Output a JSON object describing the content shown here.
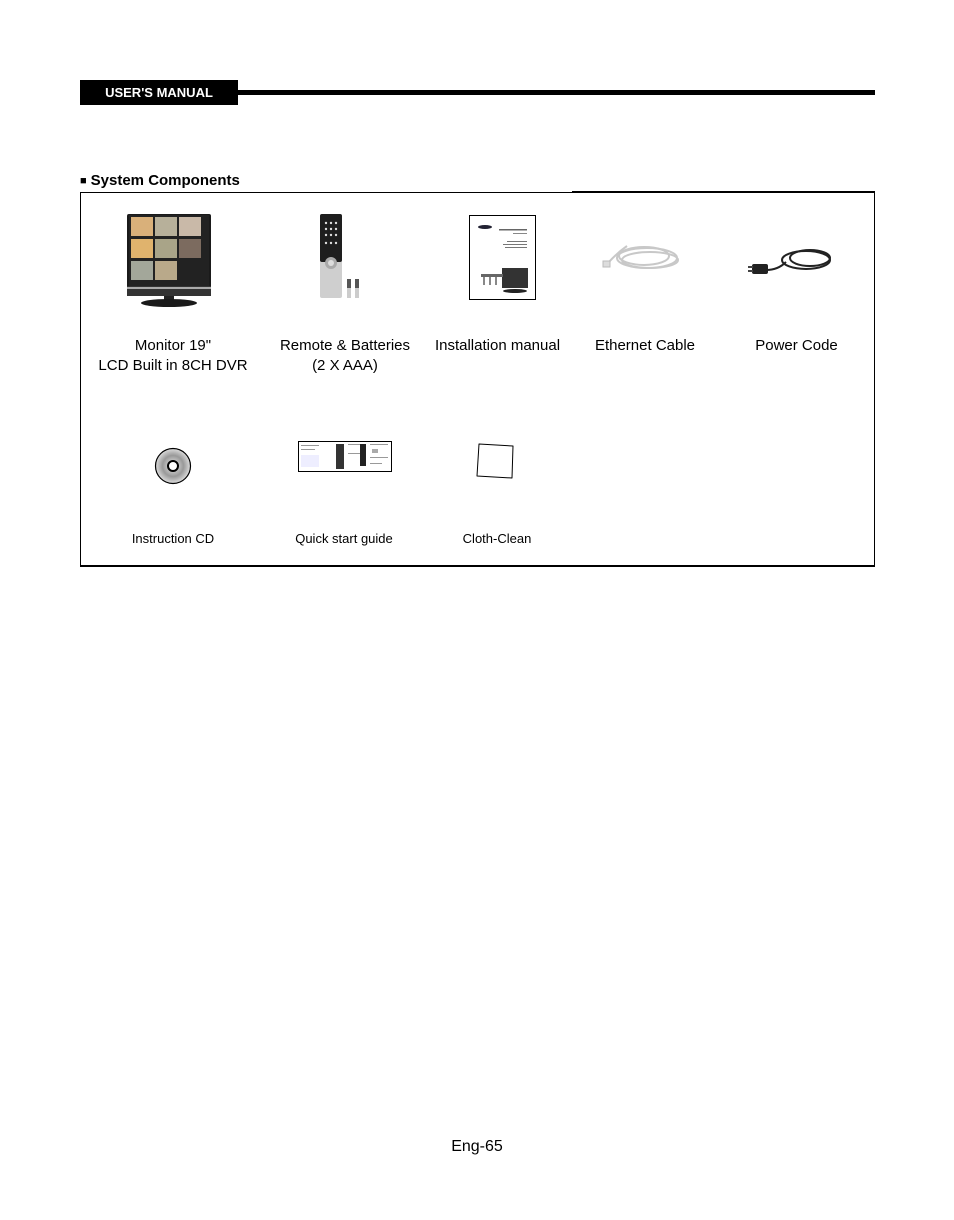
{
  "header": {
    "tab_label": "USER'S MANUAL"
  },
  "section": {
    "bullet": "■",
    "title": "System Components"
  },
  "components": [
    {
      "name": "monitor",
      "label_line1": "Monitor 19\"",
      "label_line2": "LCD Built in  8CH DVR",
      "icon": "monitor-icon"
    },
    {
      "name": "remote",
      "label_line1": "Remote & Batteries",
      "label_line2": "(2 X AAA)",
      "icon": "remote-icon"
    },
    {
      "name": "installation-manual",
      "label_line1": "Installation manual",
      "label_line2": "",
      "icon": "manual-icon"
    },
    {
      "name": "ethernet-cable",
      "label_line1": "Ethernet Cable",
      "label_line2": "",
      "icon": "ethernet-cable-icon"
    },
    {
      "name": "power-code",
      "label_line1": "Power Code",
      "label_line2": "",
      "icon": "power-cord-icon"
    },
    {
      "name": "instruction-cd",
      "label_line1": "Instruction CD",
      "label_line2": "",
      "icon": "cd-icon"
    },
    {
      "name": "quick-start-guide",
      "label_line1": "Quick start guide",
      "label_line2": "",
      "icon": "guide-icon"
    },
    {
      "name": "cloth-clean",
      "label_line1": "Cloth-Clean",
      "label_line2": "",
      "icon": "cloth-icon"
    }
  ],
  "footer": {
    "page_number": "Eng-65"
  }
}
